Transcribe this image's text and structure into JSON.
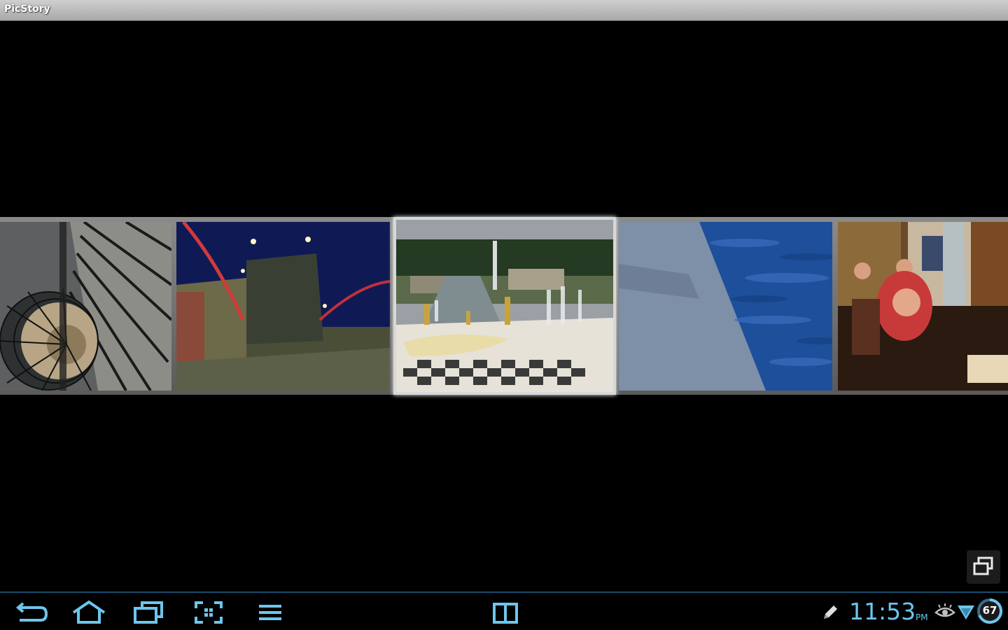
{
  "app": {
    "title": "PicStory"
  },
  "gallery": {
    "selected_index": 2,
    "photos": [
      {
        "subject": "spiral-staircase"
      },
      {
        "subject": "drawbridge-at-night"
      },
      {
        "subject": "fountain-palace"
      },
      {
        "subject": "granite-and-water"
      },
      {
        "subject": "restaurant-people"
      }
    ]
  },
  "system_bar": {
    "time": "11:53",
    "ampm": "PM",
    "battery_level": "67",
    "accent_color": "#6cc6ec",
    "buttons": [
      "back-icon",
      "home-icon",
      "recent-apps-icon",
      "screenshot-icon",
      "menu-icon",
      "split-view-icon"
    ],
    "status_icons": [
      "pencil-icon",
      "eye-icon",
      "wifi-icon",
      "battery-icon"
    ]
  }
}
